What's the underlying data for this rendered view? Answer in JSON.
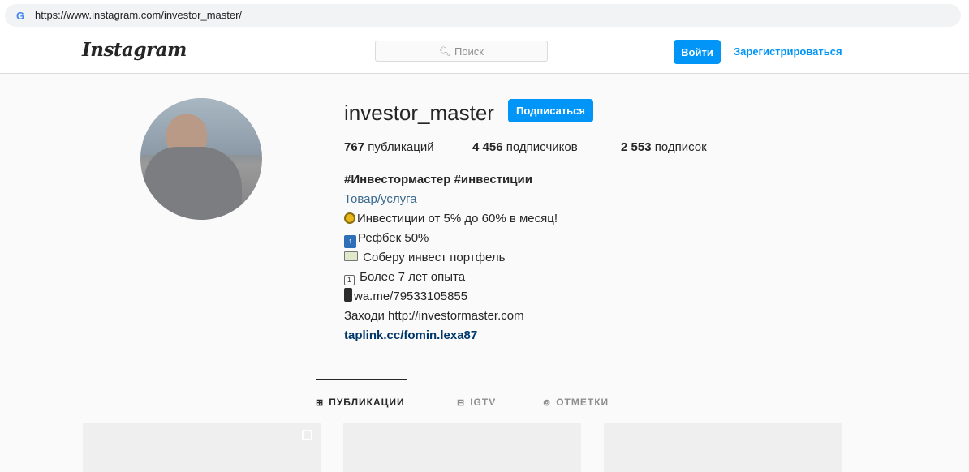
{
  "browser": {
    "url": "https://www.instagram.com/investor_master/",
    "favicon": "google-g-icon"
  },
  "header": {
    "logo": "Instagram",
    "search_placeholder": "Поиск",
    "login_label": "Войти",
    "register_label": "Зарегистрироваться"
  },
  "profile": {
    "username": "investor_master",
    "follow_label": "Подписаться",
    "stats": {
      "posts_count": "767",
      "posts_label": "публикаций",
      "followers_count": "4 456",
      "followers_label": "подписчиков",
      "following_count": "2 553",
      "following_label": "подписок"
    },
    "bio": {
      "title": "#Инвестормастер #инвестиции",
      "category": "Товар/услуга",
      "line1": "Инвестиции от 5% до 60% в месяц!",
      "line2": "Рефбек 50%",
      "line3": " Соберу инвест портфель",
      "line4": " Более 7 лет опыта",
      "line5": "wa.me/79533105855",
      "line6": "Заходи http://investormaster.com",
      "link": "taplink.cc/fomin.lexa87"
    }
  },
  "tabs": [
    {
      "label": "ПУБЛИКАЦИИ",
      "icon": "grid-icon",
      "active": true
    },
    {
      "label": "IGTV",
      "icon": "igtv-icon",
      "active": false
    },
    {
      "label": "ОТМЕТКИ",
      "icon": "tagged-icon",
      "active": false
    }
  ],
  "colors": {
    "accent": "#0095f6",
    "link": "#00376b",
    "text": "#262626",
    "muted": "#8e8e8e"
  }
}
